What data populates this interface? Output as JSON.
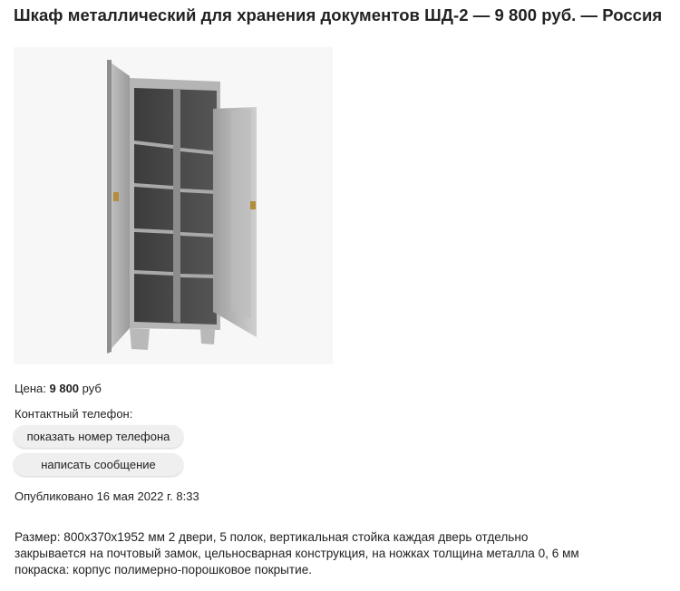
{
  "listing": {
    "title": "Шкаф металлический для хранения документов ШД-2 — 9 800 руб. — Россия",
    "image_alt": "Шкаф металлический ШД-2",
    "price_label": "Цена:",
    "price_value": "9 800",
    "price_currency": "руб",
    "phone_label": "Контактный телефон:",
    "show_phone_button": "показать номер телефона",
    "message_button": "написать сообщение",
    "published": "Опубликовано 16 мая 2022 г. 8:33",
    "description_lines": [
      "Размер: 800x370x1952 мм 2 двери, 5 полок, вертикальная стойка каждая дверь отдельно",
      "закрывается на почтовый замок, цельносварная конструкция, на ножках толщина металла 0, 6 мм",
      "покраска: корпус полимерно-порошковое покрытие."
    ]
  }
}
